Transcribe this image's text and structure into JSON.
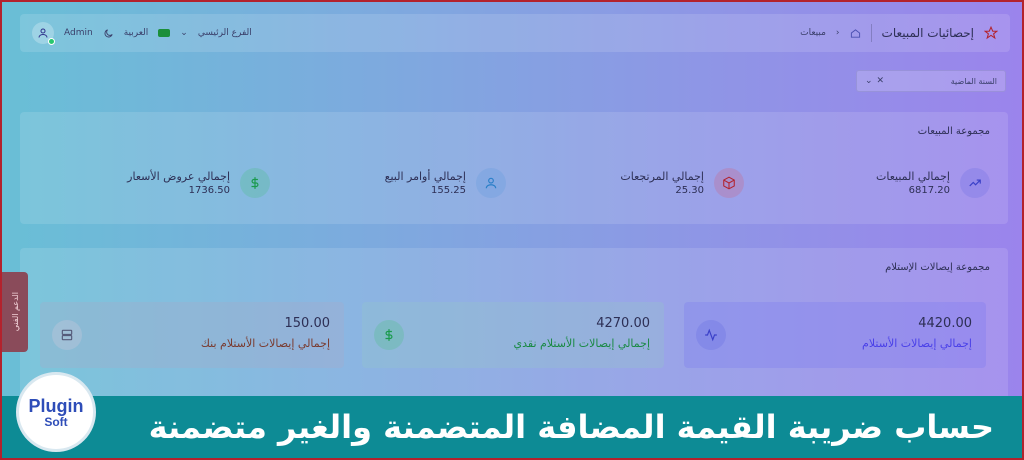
{
  "header": {
    "user_name": "Admin",
    "language": "العربية",
    "branch": "الفرع الرئيسي",
    "breadcrumb": "مبيعات",
    "page_title": "إحصائيات المبيعات"
  },
  "filter": {
    "value": "السنة الماضية"
  },
  "sales_group": {
    "title": "مجموعة المبيعات",
    "stats": [
      {
        "label": "إجمالي المبيعات",
        "value": "6817.20",
        "icon": "trend-up-icon"
      },
      {
        "label": "إجمالي المرتجعات",
        "value": "25.30",
        "icon": "box-icon"
      },
      {
        "label": "إجمالي أوامر البيع",
        "value": "155.25",
        "icon": "user-icon"
      },
      {
        "label": "إجمالي عروض الأسعار",
        "value": "1736.50",
        "icon": "dollar-icon"
      }
    ]
  },
  "receipts_group": {
    "title": "مجموعة إيصالات الإستلام",
    "boxes": [
      {
        "value": "4420.00",
        "label": "إجمالي إيصالات الأستلام",
        "icon": "activity-icon",
        "color": "#5a5cf0"
      },
      {
        "value": "4270.00",
        "label": "إجمالي إيصالات الأستلام نقدي",
        "icon": "dollar-icon",
        "color": "#1a9a4c"
      },
      {
        "value": "150.00",
        "label": "إجمالي إيصالات الأستلام بنك",
        "icon": "server-icon",
        "color": "#8b3a2e"
      }
    ]
  },
  "support_tab": "الدعم الفني",
  "banner": {
    "text": "حساب ضريبة القيمة المضافة المتضمنة والغير متضمنة"
  },
  "logo": {
    "top": "Plugin",
    "bottom": "Soft"
  }
}
